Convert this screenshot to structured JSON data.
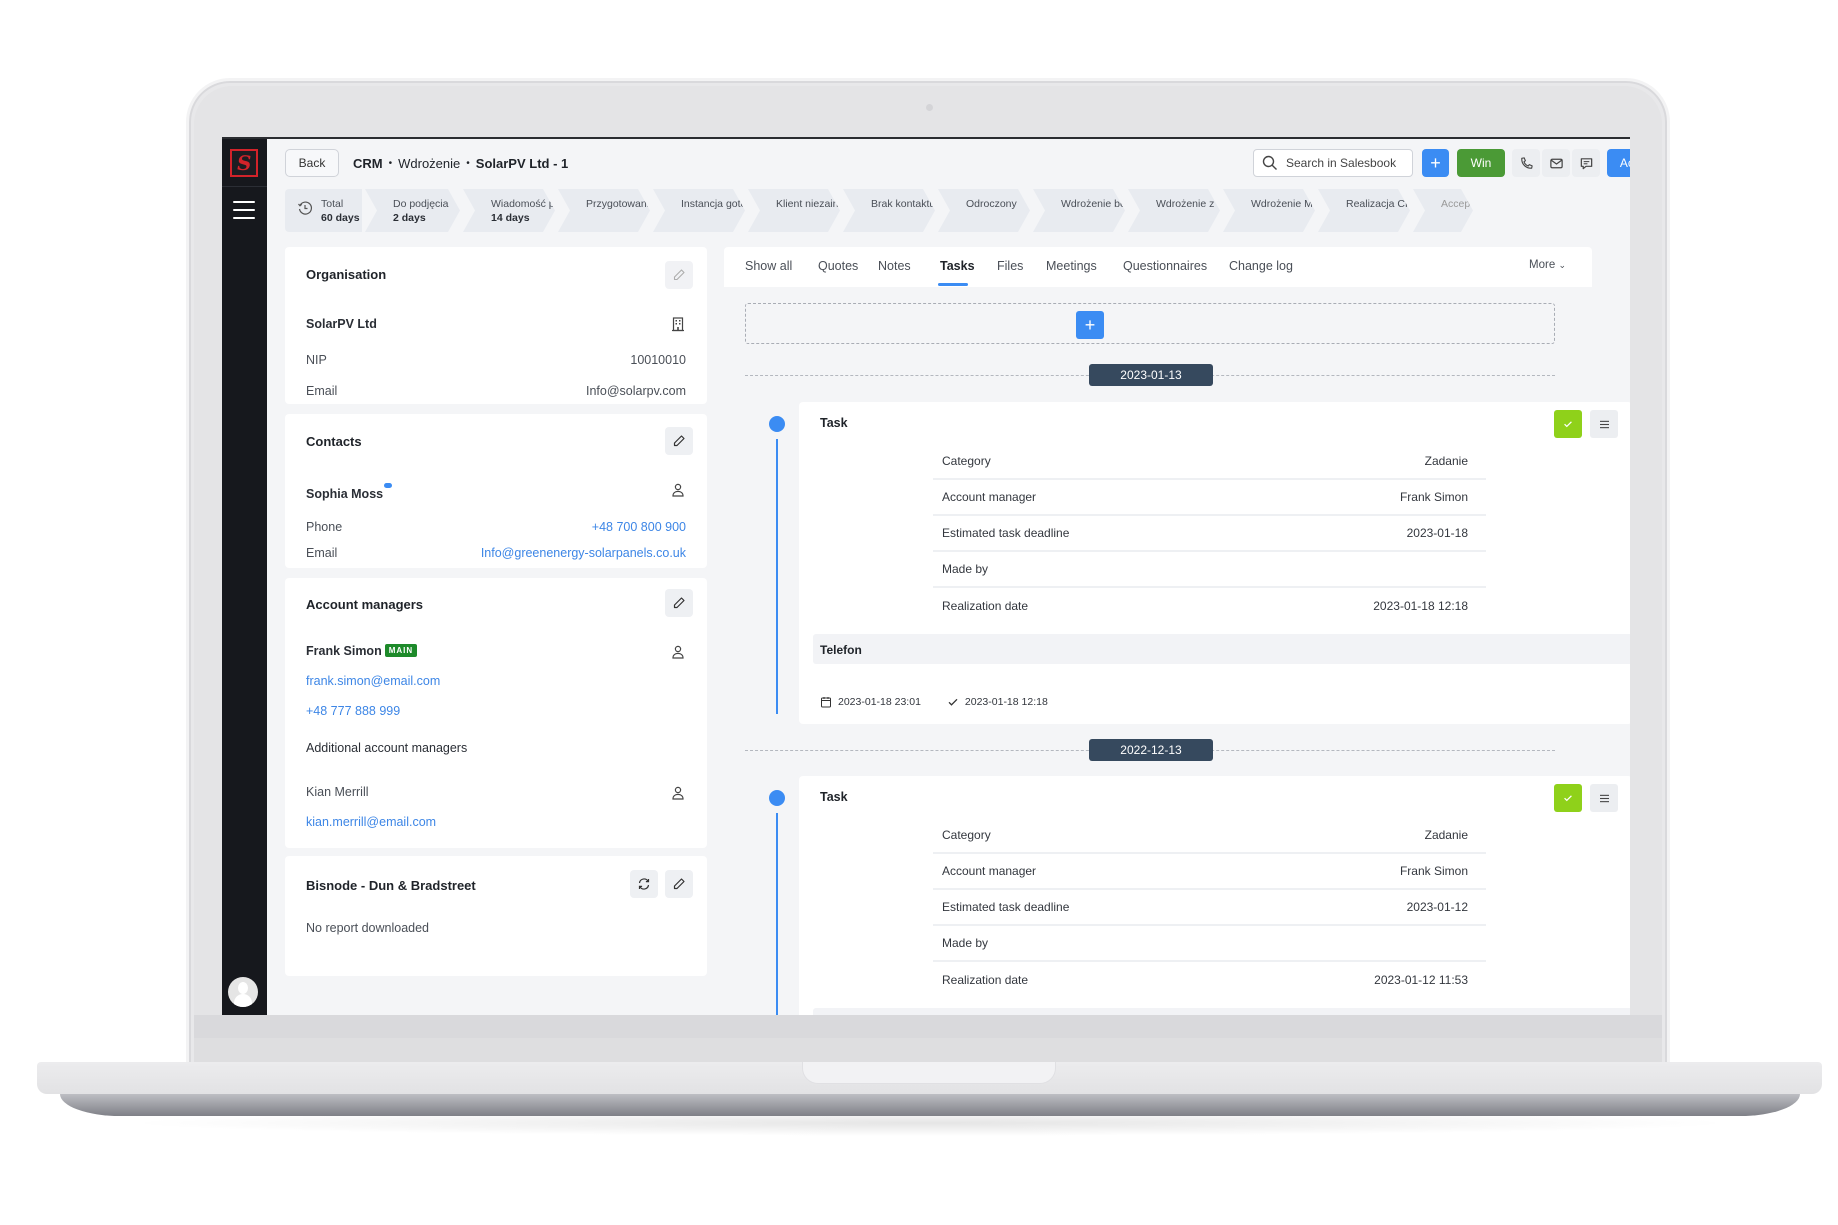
{
  "app": {
    "logo_letter": "S",
    "colors": {
      "accent": "#3b8cf3",
      "win": "#4b9a36",
      "done": "#8fd11a",
      "sidebar": "#16181d",
      "date_pill": "#36495e",
      "main_badge": "#1d8a2a",
      "logo_red": "#d2232a"
    }
  },
  "header": {
    "back_label": "Back",
    "breadcrumb": [
      "CRM",
      "Wdrożenie",
      "SolarPV Ltd - 1"
    ],
    "breadcrumb_separator": "•",
    "search_placeholder": "Search in Salesbook",
    "add_label": "+",
    "win_label": "Win",
    "actions_label": "Actions",
    "icons": [
      "search-icon",
      "phone-icon",
      "mail-icon",
      "chat-icon",
      "menu-icon"
    ]
  },
  "stages": {
    "total": {
      "label": "Total",
      "days": "60 days"
    },
    "items": [
      {
        "label": "Do podjęcia",
        "days": "2 days"
      },
      {
        "label": "Wiadomość powit...",
        "days": "14 days"
      },
      {
        "label": "Przygotowanie ins...",
        "days": ""
      },
      {
        "label": "Instancja gotowa",
        "days": ""
      },
      {
        "label": "Klient niezainteres...",
        "days": ""
      },
      {
        "label": "Brak kontaktu [wd...",
        "days": ""
      },
      {
        "label": "Odroczony",
        "days": ""
      },
      {
        "label": "Wdrożenie bez CR",
        "days": ""
      },
      {
        "label": "Wdrożenie z CR",
        "days": ""
      },
      {
        "label": "Wdrożenie MRR",
        "days": ""
      },
      {
        "label": "Realizacja CR",
        "days": ""
      },
      {
        "label": "Accep",
        "days": ""
      }
    ]
  },
  "organisation": {
    "title": "Organisation",
    "name": "SolarPV Ltd",
    "nip_label": "NIP",
    "nip": "10010010",
    "email_label": "Email",
    "email": "Info@solarpv.com"
  },
  "contacts": {
    "title": "Contacts",
    "name": "Sophia Moss",
    "phone_label": "Phone",
    "phone": "+48 700 800 900",
    "email_label": "Email",
    "email": "Info@greenenergy-solarpanels.co.uk"
  },
  "account_managers": {
    "title": "Account managers",
    "main": {
      "name": "Frank Simon",
      "badge": "MAIN",
      "email": "frank.simon@email.com",
      "phone": "+48 777 888 999"
    },
    "additional_title": "Additional account managers",
    "additional": [
      {
        "name": "Kian Merrill",
        "email": "kian.merrill@email.com"
      }
    ]
  },
  "bisnode": {
    "title": "Bisnode - Dun & Bradstreet",
    "status": "No report downloaded"
  },
  "tabs": {
    "items": [
      "Show all",
      "Quotes",
      "Notes",
      "Tasks",
      "Files",
      "Meetings",
      "Questionnaires",
      "Change log"
    ],
    "active": "Tasks",
    "more_label": "More"
  },
  "add_task_label": "+",
  "timeline": [
    {
      "date": "2023-01-13",
      "task": {
        "title": "Task",
        "fields": [
          {
            "label": "Category",
            "value": "Zadanie"
          },
          {
            "label": "Account manager",
            "value": "Frank Simon"
          },
          {
            "label": "Estimated task deadline",
            "value": "2023-01-18"
          },
          {
            "label": "Made by",
            "value": ""
          },
          {
            "label": "Realization date",
            "value": "2023-01-18 12:18"
          }
        ],
        "subtitle": "Telefon",
        "created": "2023-01-18 23:01",
        "completed": "2023-01-18 12:18"
      }
    },
    {
      "date": "2022-12-13",
      "task": {
        "title": "Task",
        "fields": [
          {
            "label": "Category",
            "value": "Zadanie"
          },
          {
            "label": "Account manager",
            "value": "Frank Simon"
          },
          {
            "label": "Estimated task deadline",
            "value": "2023-01-12"
          },
          {
            "label": "Made by",
            "value": ""
          },
          {
            "label": "Realization date",
            "value": "2023-01-12 11:53"
          }
        ]
      }
    }
  ]
}
